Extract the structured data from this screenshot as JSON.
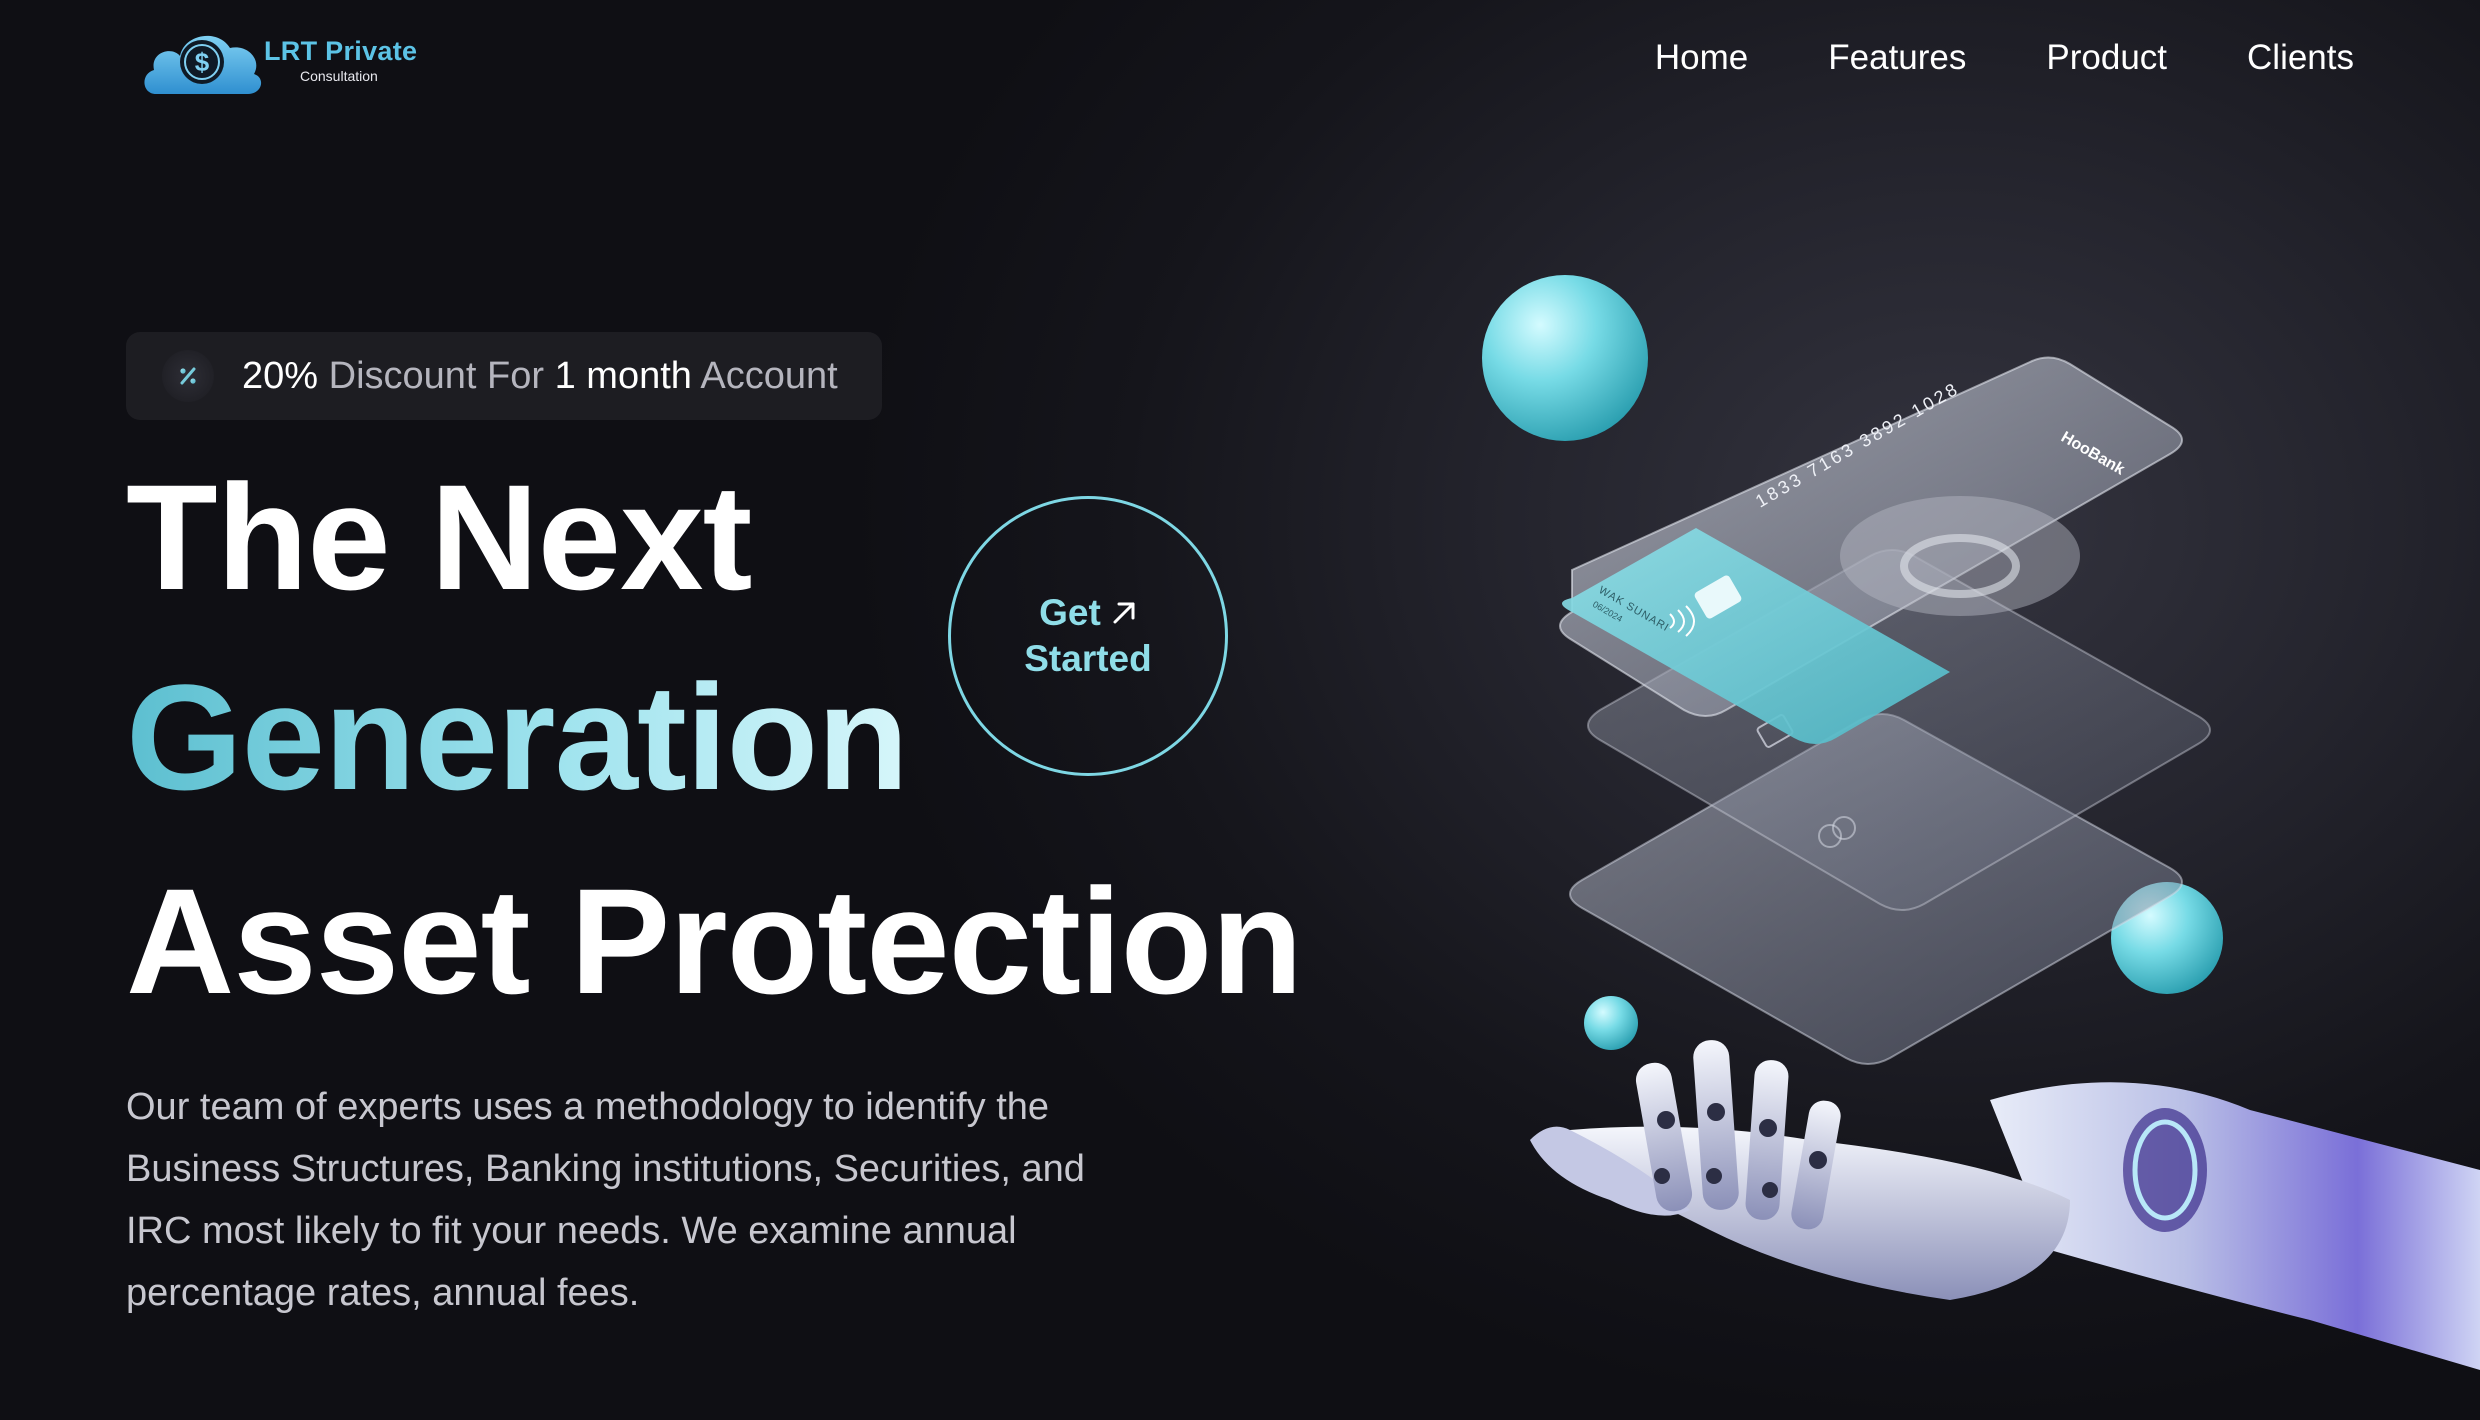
{
  "brand": {
    "title": "LRT Private",
    "subtitle": "Consultation",
    "logo_icon": "dollar-cloud-icon",
    "accent": "#5cc3e6"
  },
  "nav": {
    "items": [
      "Home",
      "Features",
      "Product",
      "Clients"
    ]
  },
  "badge": {
    "icon": "percent-icon",
    "percent": "20%",
    "text_1": " Discount For ",
    "duration": "1 month",
    "text_2": " Account"
  },
  "hero": {
    "line_1": "The Next",
    "line_2": "Generation",
    "line_3": "Asset Protection",
    "description": "Our team of experts uses a methodology to identify the Business Structures, Banking institutions, Securities, and IRC most likely to fit your needs. We examine annual percentage rates, annual fees."
  },
  "cta": {
    "line_1": "Get",
    "line_2": "Started",
    "icon": "arrow-up-right-icon",
    "color": "#7ed7e4"
  },
  "card": {
    "number": "1833 7163 3892 1028",
    "brand": "HooBank",
    "holder": "WAK SUNARI",
    "expiry": "06/2024"
  }
}
